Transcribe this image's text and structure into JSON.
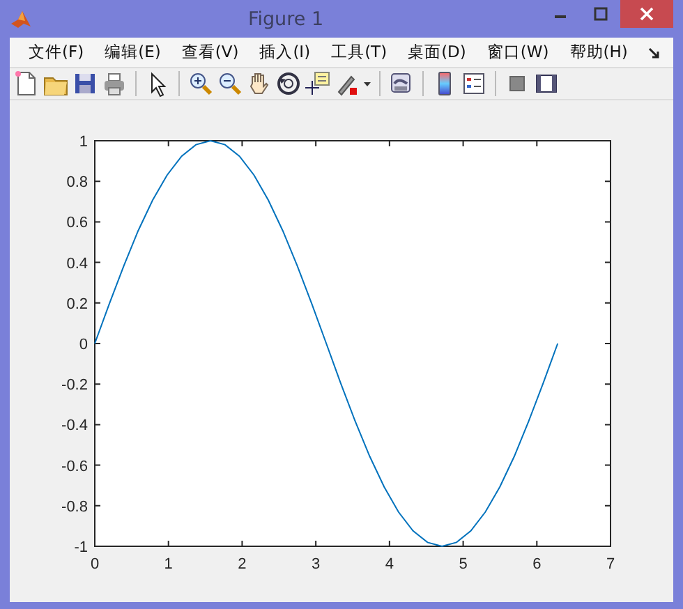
{
  "window": {
    "title": "Figure 1"
  },
  "menu": [
    {
      "label": "文件(F)"
    },
    {
      "label": "编辑(E)"
    },
    {
      "label": "查看(V)"
    },
    {
      "label": "插入(I)"
    },
    {
      "label": "工具(T)"
    },
    {
      "label": "桌面(D)"
    },
    {
      "label": "窗口(W)"
    },
    {
      "label": "帮助(H)"
    }
  ],
  "figure": {
    "chart_data": {
      "type": "line",
      "x": [
        0,
        0.196,
        0.393,
        0.589,
        0.785,
        0.982,
        1.178,
        1.374,
        1.571,
        1.767,
        1.963,
        2.16,
        2.356,
        2.553,
        2.749,
        2.945,
        3.142,
        3.338,
        3.534,
        3.731,
        3.927,
        4.123,
        4.32,
        4.516,
        4.712,
        4.909,
        5.105,
        5.301,
        5.498,
        5.694,
        5.89,
        6.087,
        6.283
      ],
      "series": [
        {
          "color": "#0072bd",
          "values": [
            0,
            0.195,
            0.383,
            0.556,
            0.707,
            0.831,
            0.924,
            0.981,
            1,
            0.981,
            0.924,
            0.831,
            0.707,
            0.556,
            0.383,
            0.195,
            0,
            -0.195,
            -0.383,
            -0.556,
            -0.707,
            -0.831,
            -0.924,
            -0.981,
            -1,
            -0.981,
            -0.924,
            -0.831,
            -0.707,
            -0.556,
            -0.383,
            -0.195,
            0
          ]
        }
      ],
      "xlim": [
        0,
        7
      ],
      "ylim": [
        -1,
        1
      ],
      "xticks": [
        0,
        1,
        2,
        3,
        4,
        5,
        6,
        7
      ],
      "yticks": [
        -1,
        -0.8,
        -0.6,
        -0.4,
        -0.2,
        0,
        0.2,
        0.4,
        0.6,
        0.8,
        1
      ]
    }
  }
}
